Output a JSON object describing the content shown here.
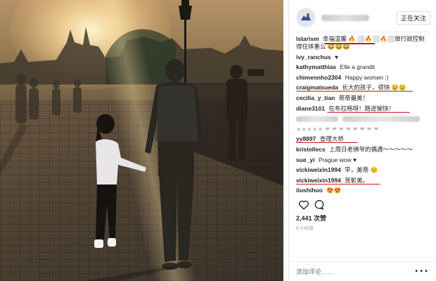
{
  "header": {
    "follow_label": "正在关注"
  },
  "caption": {
    "user": "lstarism",
    "text_line1": "幸福温馨 🔥 ⬜🔥⬜🔥⬜旅行欲控制",
    "text_line2": "得住体重么 😂😂😂"
  },
  "comments": [
    {
      "user": "ivy_ranchus",
      "text": "♥"
    },
    {
      "user": "kathymatthias",
      "text": "Elle a grandit"
    },
    {
      "user": "chimennho2304",
      "text": "Happy women :)"
    },
    {
      "user": "craigmatsueda",
      "text": "长大的孩子，很快 😢😢"
    },
    {
      "user": "cecilia_y_tian",
      "text": "蒂蒂最美！"
    },
    {
      "user": "diane3101",
      "text": "在布拉格呀！路途愉快！"
    },
    {
      "user": "",
      "text": ""
    },
    {
      "user": "",
      "text": "★★★★★ ❤ ❤ ❤ ❤ ❤ ❤ ❤ ❤"
    },
    {
      "user": "yy8897",
      "text": "查理大桥"
    },
    {
      "user": "kristellecs",
      "text": "上周日老佛爷的偶遇～～～～～"
    },
    {
      "user": "sue_yi",
      "text": "Prague wow ♥"
    },
    {
      "user": "vickiweixin1994",
      "text": "早，美蒂 😊"
    },
    {
      "user": "vickiweixin1994",
      "text": "背影美。"
    },
    {
      "user": "iiushihuo",
      "text": "😍😍"
    }
  ],
  "likes_text": "2,441 次赞",
  "time_text": "6 小时前",
  "add_comment_placeholder": "添加评论……",
  "more_label": "•••",
  "colors": {
    "highlight": "#d3161c",
    "text": "#262626",
    "muted": "#999999"
  }
}
